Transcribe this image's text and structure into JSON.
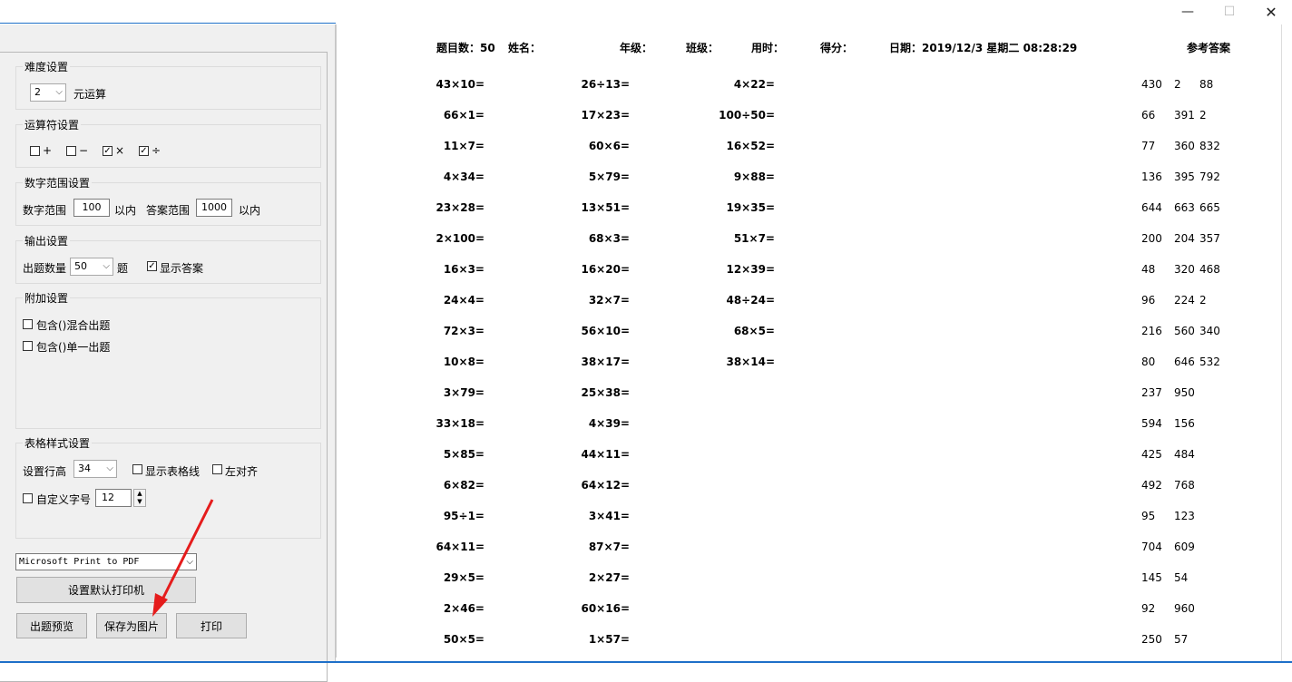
{
  "window": {
    "minimize_icon": "minimize-icon",
    "maximize_icon": "maximize-icon",
    "close_icon": "close-icon"
  },
  "settings": {
    "difficulty": {
      "legend": "难度设置",
      "operands_value": "2",
      "operands_suffix": "元运算"
    },
    "operators": {
      "legend": "运算符设置",
      "items": [
        {
          "label": "+",
          "checked": false
        },
        {
          "label": "−",
          "checked": false
        },
        {
          "label": "×",
          "checked": true
        },
        {
          "label": "÷",
          "checked": true
        }
      ]
    },
    "range": {
      "legend": "数字范围设置",
      "num_label": "数字范围",
      "num_value": "100",
      "num_suffix": "以内",
      "ans_label": "答案范围",
      "ans_value": "1000",
      "ans_suffix": "以内"
    },
    "output": {
      "legend": "输出设置",
      "count_label": "出题数量",
      "count_value": "50",
      "count_suffix": "题",
      "show_answer_label": "显示答案",
      "show_answer_checked": true
    },
    "extra": {
      "legend": "附加设置",
      "mixed_label": "包含()混合出题",
      "single_label": "包含()单一出题"
    },
    "table_style": {
      "legend": "表格样式设置",
      "row_height_label": "设置行高",
      "row_height_value": "34",
      "gridlines_label": "显示表格线",
      "left_align_label": "左对齐",
      "font_size_label": "自定义字号",
      "font_size_value": "12"
    },
    "printer": "Microsoft Print to PDF",
    "buttons": {
      "set_default_printer": "设置默认打印机",
      "preview": "出题预览",
      "save_image": "保存为图片",
      "print": "打印"
    }
  },
  "sheet": {
    "header": {
      "count": "题目数：50",
      "name": "姓名：",
      "grade": "年级：",
      "class": "班级：",
      "time": "用时：",
      "score": "得分：",
      "date": "日期：2019/12/3 星期二 08:28:29",
      "ref_answers": "参考答案"
    },
    "columns": [
      [
        "43×10=",
        "66×1=",
        "11×7=",
        "4×34=",
        "23×28=",
        "2×100=",
        "16×3=",
        "24×4=",
        "72×3=",
        "10×8=",
        "3×79=",
        "33×18=",
        "5×85=",
        "6×82=",
        "95÷1=",
        "64×11=",
        "29×5=",
        "2×46=",
        "50×5="
      ],
      [
        "26÷13=",
        "17×23=",
        "60×6=",
        "5×79=",
        "13×51=",
        "68×3=",
        "16×20=",
        "32×7=",
        "56×10=",
        "38×17=",
        "25×38=",
        "4×39=",
        "44×11=",
        "64×12=",
        "3×41=",
        "87×7=",
        "2×27=",
        "60×16=",
        "1×57="
      ],
      [
        "4×22=",
        "100÷50=",
        "16×52=",
        "9×88=",
        "19×35=",
        "51×7=",
        "12×39=",
        "48÷24=",
        "68×5=",
        "38×14="
      ]
    ],
    "answers": [
      [
        "430",
        "2",
        "88"
      ],
      [
        "66",
        "391",
        "2"
      ],
      [
        "77",
        "360",
        "832"
      ],
      [
        "136",
        "395",
        "792"
      ],
      [
        "644",
        "663",
        "665"
      ],
      [
        "200",
        "204",
        "357"
      ],
      [
        "48",
        "320",
        "468"
      ],
      [
        "96",
        "224",
        "2"
      ],
      [
        "216",
        "560",
        "340"
      ],
      [
        "80",
        "646",
        "532"
      ],
      [
        "237",
        "950"
      ],
      [
        "594",
        "156"
      ],
      [
        "425",
        "484"
      ],
      [
        "492",
        "768"
      ],
      [
        "95",
        "123"
      ],
      [
        "704",
        "609"
      ],
      [
        "145",
        "54"
      ],
      [
        "92",
        "960"
      ],
      [
        "250",
        "57"
      ]
    ]
  }
}
